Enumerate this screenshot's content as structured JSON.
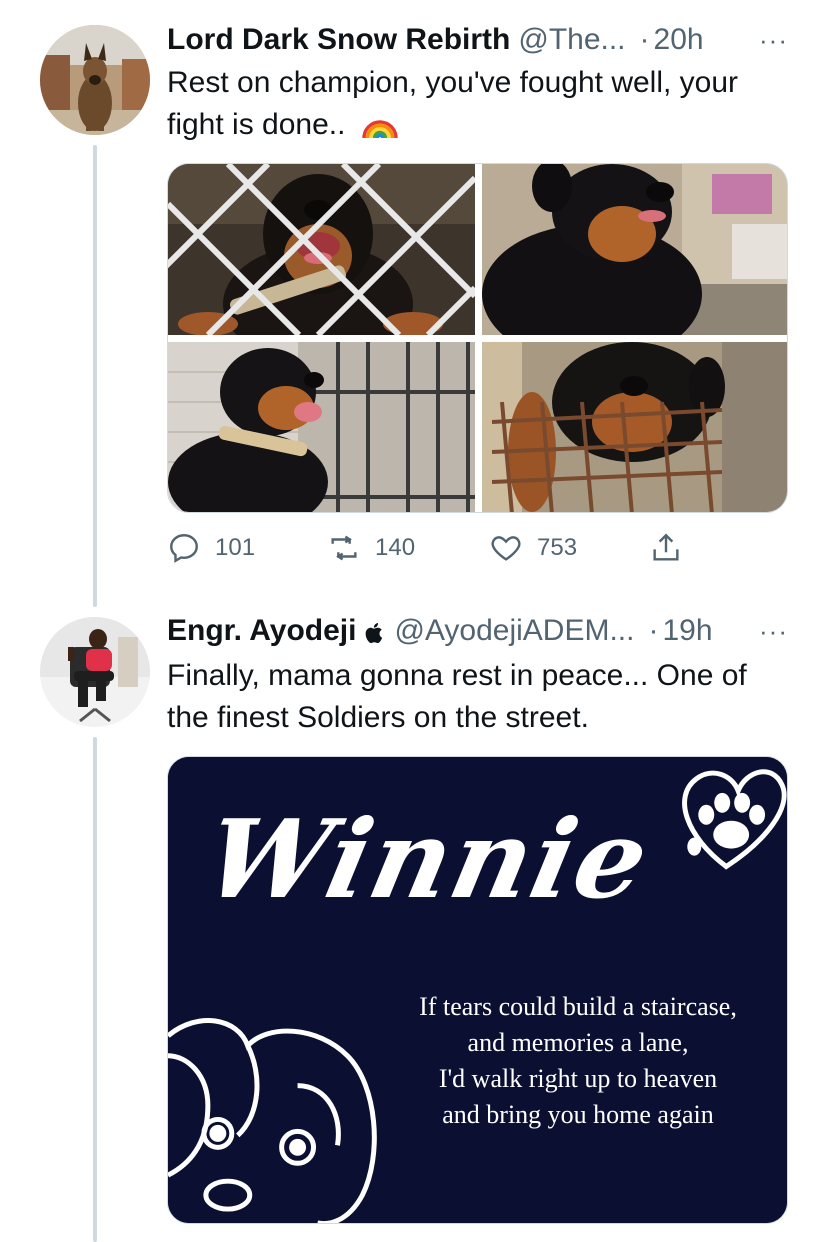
{
  "tweets": [
    {
      "name": "Lord Dark Snow Rebirth",
      "handle": "@The...",
      "dot": "·",
      "time": "20h",
      "more": "···",
      "text": "Rest on champion, you've fought well, your fight is done..",
      "emoji": "rainbow-icon",
      "avatar": "german-shepherd-avatar",
      "media": [
        "rottweiler-behind-wire-fence",
        "rottweiler-outdoors",
        "rottweiler-by-cage",
        "rottweiler-in-kennel"
      ],
      "actions": {
        "replies": "101",
        "retweets": "140",
        "likes": "753"
      }
    },
    {
      "name": "Engr. Ayodeji",
      "handle": "@AyodejiADEM...",
      "dot": "·",
      "time": "19h",
      "more": "···",
      "name_icon": "apple-icon",
      "text": "Finally, mama gonna rest in peace... One of the finest Soldiers on the street.",
      "avatar": "person-in-office-chair-avatar",
      "card": {
        "title": "Winnie",
        "poem": [
          "If tears could build a staircase,",
          "and memories a lane,",
          "I'd walk right up to heaven",
          "and bring you home again"
        ],
        "icons": [
          "paw-heart-icon",
          "puppy-outline-icon"
        ]
      }
    }
  ],
  "colors": {
    "text": "#0f1419",
    "secondary": "#536471",
    "thread_line": "#cfd9de",
    "card_bg": "#0b1032"
  }
}
